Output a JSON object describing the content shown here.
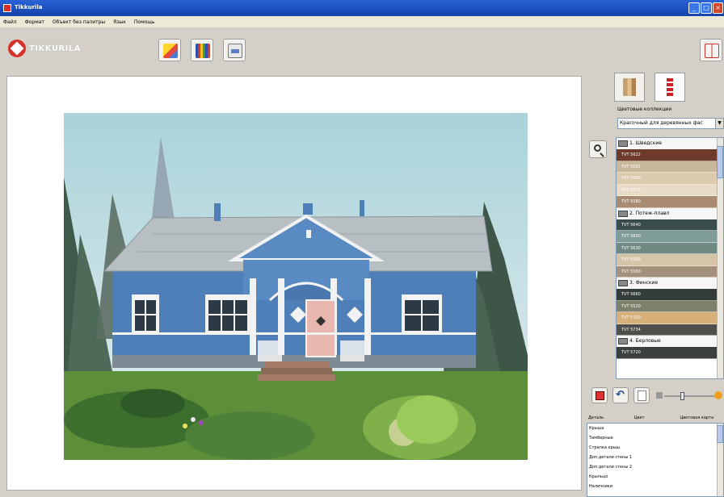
{
  "window": {
    "title": "Tikkurila"
  },
  "menu": [
    "Файл",
    "Формат",
    "Объект без палитры",
    "Язык",
    "Помощь"
  ],
  "toolbar": {
    "logo_text": "TIKKURILA",
    "buttons": [
      {
        "name": "picture-gallery-button",
        "icon": "picture-icon"
      },
      {
        "name": "color-palette-button",
        "icon": "palette-icon"
      },
      {
        "name": "print-button",
        "icon": "printer-icon"
      }
    ],
    "help_icon": "book-icon"
  },
  "right_panel": {
    "collections_label": "Цветовые коллекции",
    "collection_value": "Красочный для деревянных фас",
    "groups": [
      {
        "label": "1. Шведские",
        "swatches": [
          {
            "code": "TVT 5622",
            "color": "#6e3a2a"
          },
          {
            "code": "TVT 5561",
            "color": "#c8b89a"
          },
          {
            "code": "TVT 5600",
            "color": "#ddcbb0"
          },
          {
            "code": "TVT 5570",
            "color": "#e9dcc6"
          },
          {
            "code": "TVT 5580",
            "color": "#a88b72"
          }
        ]
      },
      {
        "label": "2. Потеж-плавл",
        "swatches": [
          {
            "code": "TVT 5640",
            "color": "#3a4c4a"
          },
          {
            "code": "TVT 5650",
            "color": "#7f9c98"
          },
          {
            "code": "TVT 5630",
            "color": "#6f8a82"
          },
          {
            "code": "TVT 5560",
            "color": "#d6c4a8"
          },
          {
            "code": "TVT 5560",
            "color": "#a5907c"
          }
        ]
      },
      {
        "label": "3. Финские",
        "swatches": [
          {
            "code": "TVT 5660",
            "color": "#353d3b"
          },
          {
            "code": "TVT 5520",
            "color": "#7d806a"
          },
          {
            "code": "TVT 5720",
            "color": "#d6b078"
          },
          {
            "code": "TVT 5734",
            "color": "#4e4e4a"
          }
        ]
      },
      {
        "label": "4. Берловые",
        "swatches": [
          {
            "code": "TVT 5720",
            "color": "#3b3f3e"
          }
        ]
      }
    ],
    "parts_table": {
      "headers": [
        "Деталь",
        "Цвет",
        "Цветовая карта"
      ],
      "rows": [
        "Крыша",
        "Тимберные",
        "Стрелка крыш",
        "Доп.детали стены 1",
        "Доп.детали стены 2",
        "Крыльцо",
        "Наличники"
      ]
    }
  }
}
